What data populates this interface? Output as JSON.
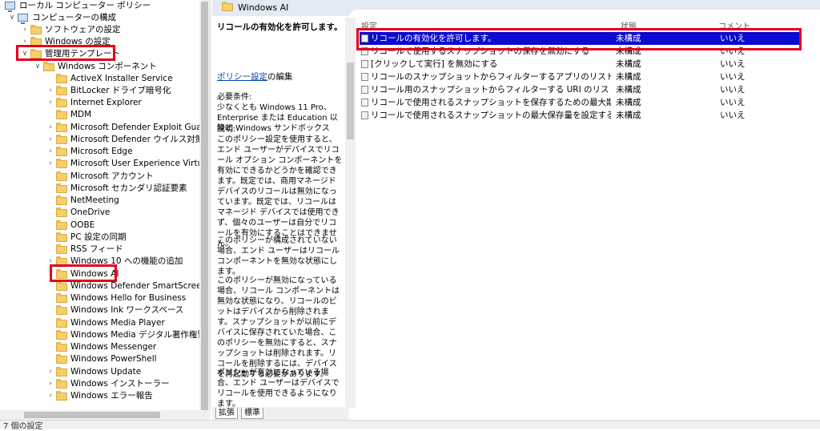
{
  "tree": {
    "items": [
      {
        "label": "ローカル コンピューター ポリシー",
        "icon": "computer-icon",
        "expanded": true
      },
      {
        "label": "コンピューターの構成",
        "icon": "computer-icon",
        "expanded": true
      },
      {
        "label": "ソフトウェアの設定",
        "icon": "folder-icon",
        "expanded": false
      },
      {
        "label": "Windows の設定",
        "icon": "folder-icon",
        "expanded": false
      },
      {
        "label": "管理用テンプレート",
        "icon": "folder-icon",
        "expanded": true
      },
      {
        "label": "Windows コンポーネント",
        "icon": "folder-icon",
        "expanded": true
      },
      {
        "label": "ActiveX Installer Service",
        "icon": "folder-icon"
      },
      {
        "label": "BitLocker ドライブ暗号化",
        "icon": "folder-icon"
      },
      {
        "label": "Internet Explorer",
        "icon": "folder-icon"
      },
      {
        "label": "MDM",
        "icon": "folder-icon"
      },
      {
        "label": "Microsoft Defender Exploit Guard",
        "icon": "folder-icon"
      },
      {
        "label": "Microsoft Defender ウイルス対策",
        "icon": "folder-icon"
      },
      {
        "label": "Microsoft Edge",
        "icon": "folder-icon"
      },
      {
        "label": "Microsoft User Experience Virtualiz",
        "icon": "folder-icon"
      },
      {
        "label": "Microsoft アカウント",
        "icon": "folder-icon"
      },
      {
        "label": "Microsoft セカンダリ認証要素",
        "icon": "folder-icon"
      },
      {
        "label": "NetMeeting",
        "icon": "folder-icon"
      },
      {
        "label": "OneDrive",
        "icon": "folder-icon"
      },
      {
        "label": "OOBE",
        "icon": "folder-icon"
      },
      {
        "label": "PC 設定の同期",
        "icon": "folder-icon"
      },
      {
        "label": "RSS フィード",
        "icon": "folder-icon"
      },
      {
        "label": "Windows 10 への機能の追加",
        "icon": "folder-icon"
      },
      {
        "label": "Windows AI",
        "icon": "folder-icon",
        "selected": true
      },
      {
        "label": "Windows Defender SmartScreen",
        "icon": "folder-icon"
      },
      {
        "label": "Windows Hello for Business",
        "icon": "folder-icon"
      },
      {
        "label": "Windows Ink ワークスペース",
        "icon": "folder-icon"
      },
      {
        "label": "Windows Media Player",
        "icon": "folder-icon"
      },
      {
        "label": "Windows Media デジタル著作権管理",
        "icon": "folder-icon"
      },
      {
        "label": "Windows Messenger",
        "icon": "folder-icon"
      },
      {
        "label": "Windows PowerShell",
        "icon": "folder-icon"
      },
      {
        "label": "Windows Update",
        "icon": "folder-icon"
      },
      {
        "label": "Windows インストーラー",
        "icon": "folder-icon"
      },
      {
        "label": "Windows エラー報告",
        "icon": "folder-icon"
      }
    ]
  },
  "header": {
    "title": "Windows AI"
  },
  "description": {
    "title": "リコールの有効化を許可します。",
    "link": "ポリシー設定",
    "link_suffix": "の編集",
    "requirements": "必要条件:\n少なくとも Windows 11 Pro、Enterprise または Education 以降と Windows サンドボックス",
    "explanation": "説明:\nこのポリシー設定を使用すると、エンド ユーザーがデバイスでリコール オプション コンポーネントを有効にできるかどうかを確認できます。既定では、商用マネージド デバイスのリコールは無効になっています。既定では、リコールはマネージド デバイスでは使用できず、個々のユーザーは自分でリコールを有効にすることはできません。",
    "not_configured": "このポリシーが構成されていない場合、エンド ユーザーはリコール コンポーネントを無効な状態にします。",
    "disabled": "このポリシーが無効になっている場合、リコール コンポーネントは無効な状態になり、リコールのビットはデバイスから削除されます。スナップショットが以前にデバイスに保存されていた場合、このポリシーを無効にすると、スナップショットは削除されます。リコールを削除するには、デバイスを再起動する必要があります。",
    "enabled": "ポリシーが有効になっている場合、エンド ユーザーはデバイスでリコールを使用できるようになります。\nDisableAIDataAnalysis ポリシーの状"
  },
  "tabs": {
    "extended": "拡張",
    "standard": "標準"
  },
  "list": {
    "columns": {
      "setting": "設定",
      "state": "状態",
      "comment": "コメント"
    },
    "rows": [
      {
        "name": "リコールの有効化を許可します。",
        "state": "未構成",
        "comment": "いいえ",
        "selected": true
      },
      {
        "name": "リコールで使用するスナップショットの保存を無効にする",
        "state": "未構成",
        "comment": "いいえ"
      },
      {
        "name": "[クリックして実行] を無効にする",
        "state": "未構成",
        "comment": "いいえ"
      },
      {
        "name": "リコールのスナップショットからフィルターするアプリのリストを設定する",
        "state": "未構成",
        "comment": "いいえ"
      },
      {
        "name": "リコール用のスナップショットからフィルターする URI のリストを設定する ...",
        "state": "未構成",
        "comment": "いいえ"
      },
      {
        "name": "リコールで使用されるスナップショットを保存するための最大期間を設...",
        "state": "未構成",
        "comment": "いいえ"
      },
      {
        "name": "リコールで使用されるスナップショットの最大保存量を設定する",
        "state": "未構成",
        "comment": "いいえ"
      }
    ]
  },
  "status": {
    "text": "7 個の設定"
  },
  "colors": {
    "accent_red": "#e3001b",
    "selection_blue": "#0a0ad0"
  }
}
